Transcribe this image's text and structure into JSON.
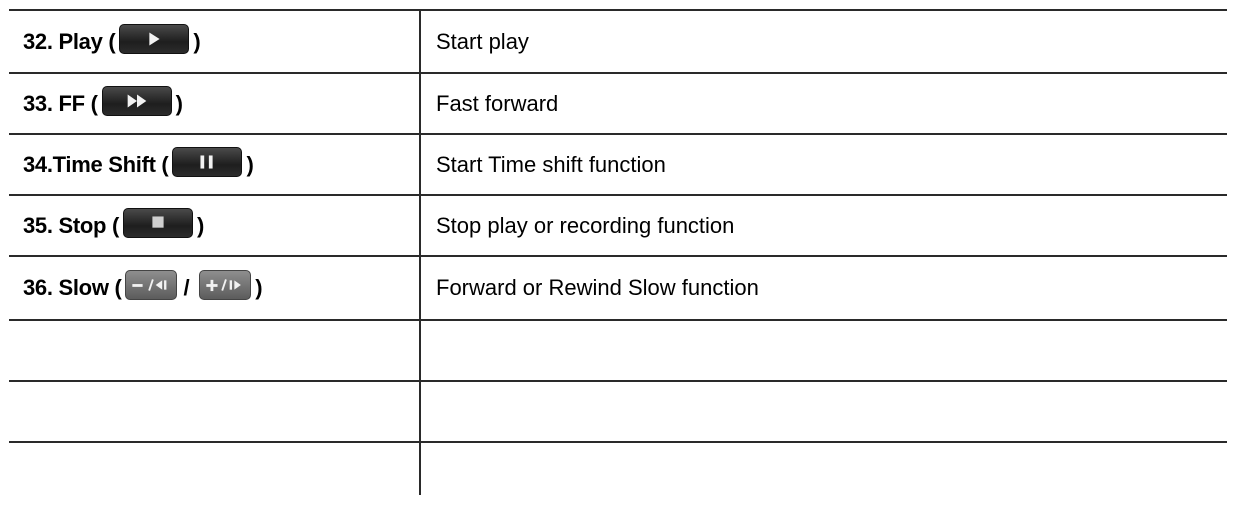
{
  "rows": [
    {
      "left_prefix": "32. Play (",
      "left_suffix": ")",
      "icon": "play-icon",
      "right": "Start play"
    },
    {
      "left_prefix": "33. FF (",
      "left_suffix": ")",
      "icon": "fast-forward-icon",
      "right": "Fast forward"
    },
    {
      "left_prefix": "34.Time Shift (",
      "left_suffix": ")",
      "icon": "pause-icon",
      "right": "Start Time shift function"
    },
    {
      "left_prefix": "35. Stop (",
      "left_suffix": ")",
      "icon": "stop-icon",
      "right": "Stop play or recording function"
    },
    {
      "left_prefix": "36. Slow (",
      "left_separator": "/",
      "left_suffix": ")",
      "icons": [
        "slow-rewind-icon",
        "slow-forward-icon"
      ],
      "right": "Forward or Rewind Slow function"
    }
  ],
  "empty_rows": 3
}
